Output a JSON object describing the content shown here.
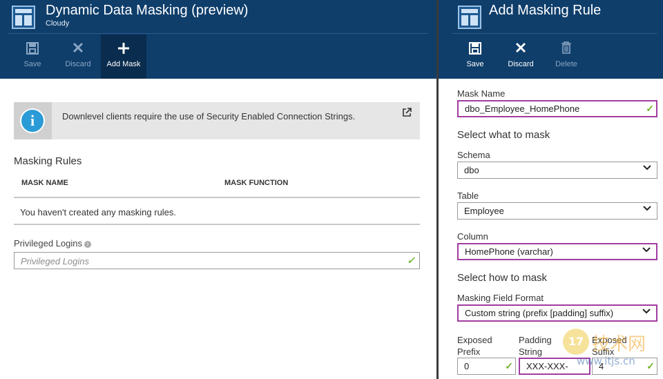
{
  "left": {
    "title": "Dynamic Data Masking (preview)",
    "subtitle": "Cloudy",
    "toolbar": {
      "save": "Save",
      "discard": "Discard",
      "add_mask": "Add Mask"
    },
    "info": {
      "text": "Downlevel clients require the use of Security Enabled Connection Strings."
    },
    "masking_rules": {
      "title": "Masking Rules",
      "columns": [
        "MASK NAME",
        "MASK FUNCTION"
      ],
      "empty": "You haven't created any masking rules."
    },
    "privileged_logins": {
      "label": "Privileged Logins",
      "placeholder": "Privileged Logins"
    }
  },
  "right": {
    "title": "Add Masking Rule",
    "toolbar": {
      "save": "Save",
      "discard": "Discard",
      "delete": "Delete"
    },
    "mask_name": {
      "label": "Mask Name",
      "value": "dbo_Employee_HomePhone"
    },
    "select_what": "Select what to mask",
    "schema": {
      "label": "Schema",
      "value": "dbo"
    },
    "table": {
      "label": "Table",
      "value": "Employee"
    },
    "column": {
      "label": "Column",
      "value": "HomePhone (varchar)"
    },
    "select_how": "Select how to mask",
    "format": {
      "label": "Masking Field Format",
      "value": "Custom string (prefix [padding] suffix)"
    },
    "exposed_prefix": {
      "label1": "Exposed",
      "label2": "Prefix",
      "value": "0"
    },
    "padding_string": {
      "label1": "Padding",
      "label2": "String",
      "value": "XXX-XXX-"
    },
    "exposed_suffix": {
      "label1": "Exposed",
      "label2": "Suffix",
      "value": "4"
    }
  },
  "watermark": {
    "badge": "17",
    "text": "技术网",
    "url": "www.itjs.cn"
  },
  "colors": {
    "header": "#0f3e6b",
    "accent_purple": "#a03ca0",
    "check_green": "#6fb52c"
  }
}
